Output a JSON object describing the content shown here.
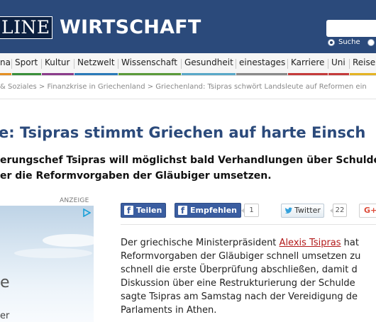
{
  "header": {
    "logo_text": "LINE",
    "section_title": "WIRTSCHAFT",
    "search": {
      "placeholder": "",
      "option_selected": "Suche",
      "option_other": ""
    },
    "background": "#2b4a7b"
  },
  "nav": {
    "items": [
      {
        "label": "na",
        "color": "#e48f23"
      },
      {
        "label": "Sport",
        "color": "#3a8f3a"
      },
      {
        "label": "Kultur",
        "color": "#8a3c8a"
      },
      {
        "label": "Netzwelt",
        "color": "#2a7ab8"
      },
      {
        "label": "Wissenschaft",
        "color": "#5a9a3a"
      },
      {
        "label": "Gesundheit",
        "color": "#59a8c8"
      },
      {
        "label": "einestages",
        "color": "#8a8a8a"
      },
      {
        "label": "Karriere",
        "color": "#c43a3a"
      },
      {
        "label": "Uni",
        "color": "#c43a3a"
      },
      {
        "label": "Reise",
        "color": "#e4b323"
      }
    ]
  },
  "breadcrumb": "& Soziales > Finanzkrise in Griechenland > Griechenland: Tsipras schwört Landsleute auf Reformen ein",
  "article": {
    "kicker": "e: ",
    "title": "Tsipras stimmt Griechen auf harte Einsch",
    "teaser_line1": "erungschef Tsipras will möglichst bald Verhandlungen über Schulde",
    "teaser_line2": "er die Reformvorgaben der Gläubiger umsetzen.",
    "body": {
      "line1_before": "Der griechische Ministerpräsident ",
      "line1_link": "Alexis Tsipras",
      "line1_after": " hat",
      "line2": "Reformvorgaben der Gläubiger schnell umsetzen zu",
      "line3": "schnell die erste Überprüfung abschließen, damit d",
      "line4": "Diskussion über eine Restrukturierung der Schulde",
      "line5": "sagte Tsipras am Samstag nach der Vereidigung de",
      "line6": "Parlaments in Athen."
    }
  },
  "ad": {
    "label": "ANZEIGE",
    "choice_icon": "adchoices-icon",
    "text_big": "e",
    "text_small": "er"
  },
  "share": {
    "facebook_share_label": "Teilen",
    "facebook_recommend_label": "Empfehlen",
    "facebook_count": "1",
    "twitter_label": "Twitter",
    "twitter_count": "22",
    "google_label": "G+",
    "facebook_color": "#3a5da0",
    "twitter_color": "#33a1dc",
    "google_color": "#dd4b39"
  }
}
